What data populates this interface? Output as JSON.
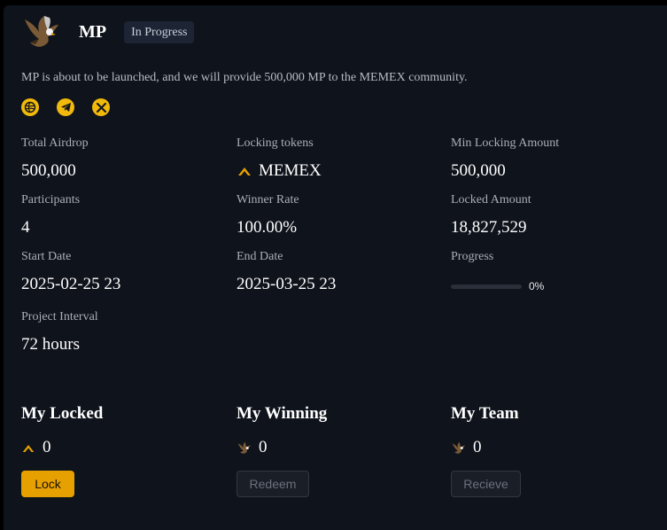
{
  "header": {
    "title": "MP",
    "status_badge": "In Progress",
    "logo_icon": "eagle-icon"
  },
  "description": "MP is about to be launched, and we will provide 500,000 MP to the MEMEX community.",
  "socials": [
    {
      "name": "website",
      "icon": "globe-icon"
    },
    {
      "name": "telegram",
      "icon": "telegram-icon"
    },
    {
      "name": "x",
      "icon": "x-icon"
    }
  ],
  "stats": {
    "total_airdrop": {
      "label": "Total Airdrop",
      "value": "500,000"
    },
    "locking_tokens": {
      "label": "Locking tokens",
      "value": "MEMEX",
      "icon": "memex-icon"
    },
    "min_locking_amount": {
      "label": "Min Locking Amount",
      "value": "500,000"
    },
    "participants": {
      "label": "Participants",
      "value": "4"
    },
    "winner_rate": {
      "label": "Winner Rate",
      "value": "100.00%"
    },
    "locked_amount": {
      "label": "Locked Amount",
      "value": "18,827,529"
    },
    "start_date": {
      "label": "Start Date",
      "value": "2025-02-25 23"
    },
    "end_date": {
      "label": "End Date",
      "value": "2025-03-25 23"
    },
    "progress": {
      "label": "Progress",
      "value_text": "0%",
      "fraction": 0
    },
    "project_interval": {
      "label": "Project Interval",
      "value": "72 hours"
    }
  },
  "sections": {
    "my_locked": {
      "title": "My Locked",
      "value": "0",
      "icon": "memex-icon",
      "button": "Lock"
    },
    "my_winning": {
      "title": "My Winning",
      "value": "0",
      "icon": "eagle-icon",
      "button": "Redeem"
    },
    "my_team": {
      "title": "My Team",
      "value": "0",
      "icon": "eagle-icon",
      "button": "Recieve"
    }
  },
  "colors": {
    "accent": "#f0b90b",
    "button_primary": "#e6a100",
    "card_bg": "#0f131b",
    "page_bg": "#000000"
  }
}
